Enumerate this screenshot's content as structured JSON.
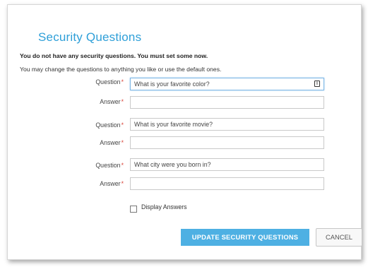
{
  "form": {
    "title": "Security Questions",
    "notice": "You do not have any security questions. You must set some now.",
    "hint": "You may change the questions to anything you like or use the default ones.",
    "required_mark": "*",
    "question_label": "Question",
    "answer_label": "Answer",
    "questions": [
      {
        "question": "What is your favorite color?",
        "answer": ""
      },
      {
        "question": "What is your favorite movie?",
        "answer": ""
      },
      {
        "question": "What city were you born in?",
        "answer": ""
      }
    ],
    "display_answers_label": "Display Answers",
    "display_answers_checked": false,
    "submit_label": "UPDATE SECURITY QUESTIONS",
    "cancel_label": "CANCEL"
  },
  "colors": {
    "accent": "#2e9fd8",
    "primary_button": "#4eb0e3",
    "required": "#d9443a"
  },
  "icons": {
    "field_icon": "text-cursor-icon"
  }
}
